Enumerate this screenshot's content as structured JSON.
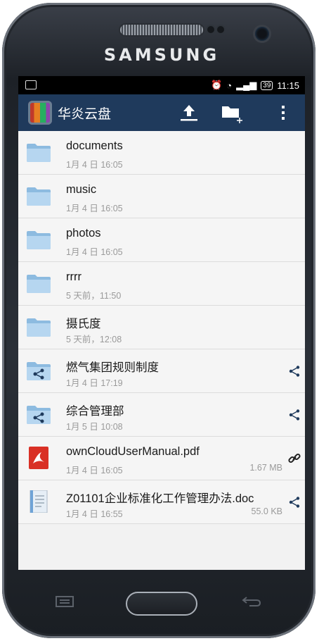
{
  "device": {
    "brand": "SAMSUNG"
  },
  "status_bar": {
    "time": "11:15",
    "battery": "39"
  },
  "app_bar": {
    "title": "华炎云盘",
    "icons": [
      "upload-icon",
      "new-folder-icon",
      "overflow-menu-icon"
    ]
  },
  "files": [
    {
      "name": "documents",
      "date": "1月 4 日 16:05",
      "type": "folder",
      "size": "",
      "action": ""
    },
    {
      "name": "music",
      "date": "1月 4 日 16:05",
      "type": "folder",
      "size": "",
      "action": ""
    },
    {
      "name": "photos",
      "date": "1月 4 日 16:05",
      "type": "folder",
      "size": "",
      "action": ""
    },
    {
      "name": "rrrr",
      "date": "5 天前，11:50",
      "type": "folder",
      "size": "",
      "action": ""
    },
    {
      "name": "摄氏度",
      "date": "5 天前，12:08",
      "type": "folder",
      "size": "",
      "action": ""
    },
    {
      "name": "燃气集团规则制度",
      "date": "1月 4 日 17:19",
      "type": "shared-folder",
      "size": "",
      "action": "share"
    },
    {
      "name": "综合管理部",
      "date": "1月 5 日 10:08",
      "type": "shared-folder",
      "size": "",
      "action": "share"
    },
    {
      "name": "ownCloudUserManual.pdf",
      "date": "1月 4 日 16:05",
      "type": "pdf",
      "size": "1.67 MB",
      "action": "link"
    },
    {
      "name": "Z01101企业标准化工作管理办法.doc",
      "date": "1月 4 日 16:55",
      "type": "doc",
      "size": "55.0 KB",
      "action": "share"
    }
  ]
}
